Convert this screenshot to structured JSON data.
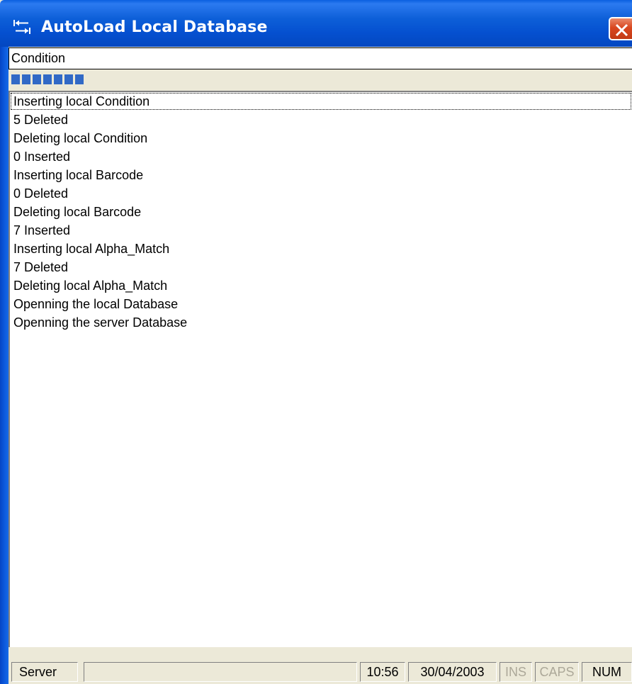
{
  "window": {
    "title": "AutoLoad Local Database",
    "title_icon": "transfer-arrows-icon",
    "close_icon": "close-x-icon"
  },
  "condition_field": {
    "value": "Condition"
  },
  "progress": {
    "filled_blocks": 7
  },
  "log": {
    "lines": [
      "Inserting local Condition",
      "5 Deleted",
      "Deleting local Condition",
      "0 Inserted",
      "Inserting local Barcode",
      "0 Deleted",
      "Deleting local Barcode",
      "7 Inserted",
      "Inserting local Alpha_Match",
      "7 Deleted",
      "Deleting local Alpha_Match",
      "Openning the local Database",
      "Openning the server Database"
    ]
  },
  "statusbar": {
    "mode": "Server",
    "message": "",
    "time": "10:56",
    "date": "30/04/2003",
    "ins": "INS",
    "caps": "CAPS",
    "num": "NUM"
  },
  "colors": {
    "titlebar": "#0550d0",
    "progress": "#3169c6",
    "close_button": "#d9471f",
    "disabled_text": "#aca899"
  }
}
